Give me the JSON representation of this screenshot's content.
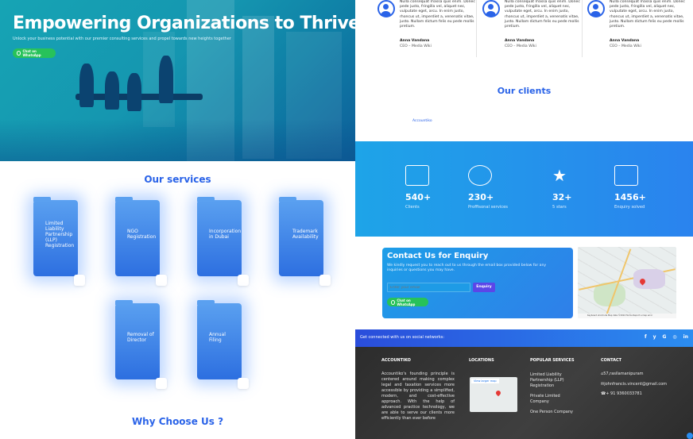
{
  "hero": {
    "title": "Empowering Organizations to Thrive",
    "subtitle": "Unlock your business potential with our premier consulting services and propel towards new heights together",
    "whatsapp": "Chat on WhatsApp"
  },
  "services": {
    "title": "Our services",
    "items": [
      "Limited Liability Partnership (LLP) Registration",
      "NGO Registration",
      "Incorporation in Dubai",
      "Trademark Availability",
      "Removal of Director",
      "Annual Filing"
    ]
  },
  "why": {
    "title": "Why Choose Us ?"
  },
  "testimonials": [
    {
      "quote": "Nulla consequat massa quis enim. Donec pede justo, fringilla vel, aliquet nec, vulputate eget, arcu. In enim justo, rhoncus ut, imperdiet a, venenatis vitae, justo. Nullam dictum felis eu pede mollis pretium.",
      "name": "Anna Vandana",
      "role": "CEO – Media Wiki"
    },
    {
      "quote": "Nulla consequat massa quis enim. Donec pede justo, fringilla vel, aliquet nec, vulputate eget, arcu. In enim justo, rhoncus ut, imperdiet a, venenatis vitae, justo. Nullam dictum felis eu pede mollis pretium.",
      "name": "Anna Vandana",
      "role": "CEO – Media Wiki"
    },
    {
      "quote": "Nulla consequat massa quis enim. Donec pede justo, fringilla vel, aliquet nec, vulputate eget, arcu. In enim justo, rhoncus ut, imperdiet a, venenatis vitae, justo. Nullam dictum felis eu pede mollis pretium.",
      "name": "Anna Vandana",
      "role": "CEO – Media Wiki"
    }
  ],
  "clients": {
    "title": "Our clients",
    "logo": "Accountiko"
  },
  "stats": [
    {
      "num": "540+",
      "label": "Clients"
    },
    {
      "num": "230+",
      "label": "Proffisonal services"
    },
    {
      "num": "32+",
      "label": "5 stars"
    },
    {
      "num": "1456+",
      "label": "Enquiry solved"
    }
  ],
  "enquiry": {
    "title": "Contact Us for Enquiry",
    "text": "We kindly request you to reach out to us through the email box provided below for any inquiries or questions you may have.",
    "placeholder": "Enter your email",
    "button": "Enquiry",
    "whatsapp": "Chat on WhatsApp"
  },
  "map": {
    "attribution": "Keyboard shortcuts  Map data ©2024  Terms  Report a map error"
  },
  "footer": {
    "social_text": "Get connected with us on social networks:",
    "social": [
      "f",
      "y",
      "G",
      "in"
    ],
    "col1_title": "ACCOUNTIKO",
    "col1_text": "Accountiko's founding principle is centered around making complex legal and taxation services more accessible by providing a simplified, modern, and cost-effective approach. With the help of advanced practice technology, we are able to serve our clients more efficiently than ever before",
    "col2_title": "LOCATIONS",
    "col2_map": "View larger map",
    "col3_title": "POPULAR SERVICES",
    "col3_items": [
      "Limited Liability Partnership (LLP) Registration",
      "Private Limited Company",
      "One Person Company"
    ],
    "col4_title": "CONTACT",
    "address": "57,rasilamanipuram",
    "email": "johnfrancis.vincent@gmail.com",
    "phone": "+ 91 9360033781"
  },
  "colors": {
    "accent": "#2a63e8",
    "whatsapp": "#27c25a"
  }
}
